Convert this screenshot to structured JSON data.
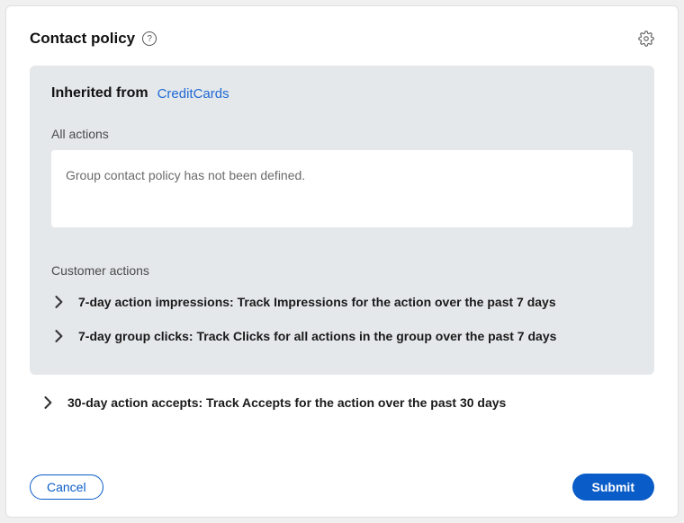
{
  "header": {
    "title": "Contact policy"
  },
  "inherited": {
    "label": "Inherited from",
    "source": "CreditCards"
  },
  "allActions": {
    "heading": "All actions",
    "emptyMessage": "Group contact policy has not been defined."
  },
  "customerActions": {
    "heading": "Customer actions",
    "items": [
      {
        "label": "7-day action impressions: Track Impressions for the action over the past 7 days"
      },
      {
        "label": "7-day group clicks: Track Clicks for all actions in the group over the past 7 days"
      }
    ]
  },
  "standalone": {
    "label": "30-day action accepts: Track Accepts for the action over the past 30 days"
  },
  "footer": {
    "cancel": "Cancel",
    "submit": "Submit"
  }
}
